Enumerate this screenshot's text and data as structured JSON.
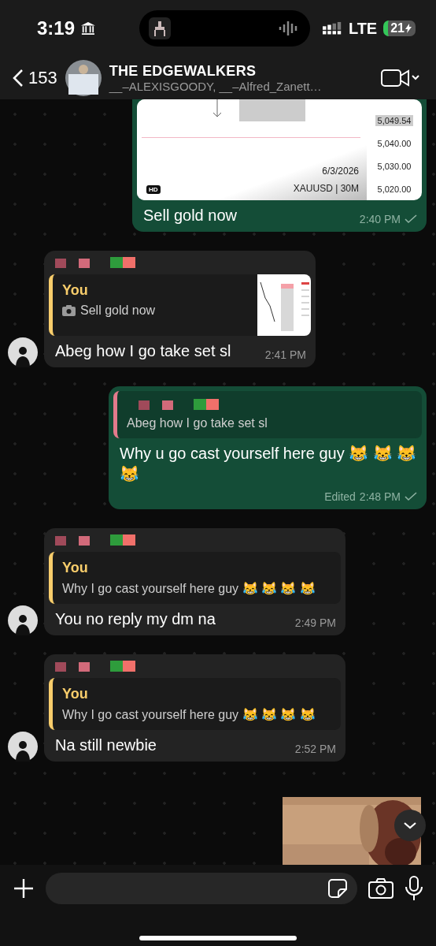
{
  "status_bar": {
    "time": "3:19",
    "network": "LTE",
    "battery": "21"
  },
  "header": {
    "back_count": "153",
    "title": "THE EDGEWALKERS",
    "subtitle": "__–ALEXISGOODY, __–Alfred_Zanett…"
  },
  "messages": [
    {
      "outgoing": true,
      "image": {
        "price_labels": [
          {
            "text": "5,049.54",
            "highlighted": true
          },
          {
            "text": "5,040.00",
            "highlighted": false
          },
          {
            "text": "5,030.00",
            "highlighted": false
          },
          {
            "text": "5,020.00",
            "highlighted": false
          }
        ],
        "date": "6/3/2026",
        "symbol": "XAUUSD | 30M",
        "badge": "HD"
      },
      "text": "Sell gold now",
      "time": "2:40 PM",
      "sent": true
    },
    {
      "kind": "text",
      "outgoing": false,
      "sender_redacted": true,
      "reply": {
        "author": "You",
        "text": "Sell gold now",
        "photo": true
      },
      "text": "Abeg how I go take set sl",
      "time": "2:41 PM",
      "sent": false
    },
    {
      "kind": "text",
      "outgoing": true,
      "sender_redacted": false,
      "reply": {
        "text": "Abeg how I go take set sl"
      },
      "text": "Why u go cast yourself here guy 😹 😹 😹 😹",
      "edited_label": "Edited",
      "time": "2:48 PM",
      "sent": true
    },
    {
      "kind": "text",
      "outgoing": false,
      "sender_redacted": true,
      "reply": {
        "author": "You",
        "text": "Why I go cast yourself here guy 😹 😹 😹 😹"
      },
      "text": "You no reply my dm na",
      "time": "2:49 PM",
      "sent": false
    },
    {
      "kind": "text",
      "outgoing": false,
      "sender_redacted": true,
      "reply": {
        "author": "You",
        "text": "Why I go cast yourself here guy 😹 😹 😹 😹"
      },
      "text": "Na still newbie",
      "time": "2:52 PM",
      "sent": false
    },
    {
      "kind": "picture",
      "outgoing": true
    }
  ]
}
